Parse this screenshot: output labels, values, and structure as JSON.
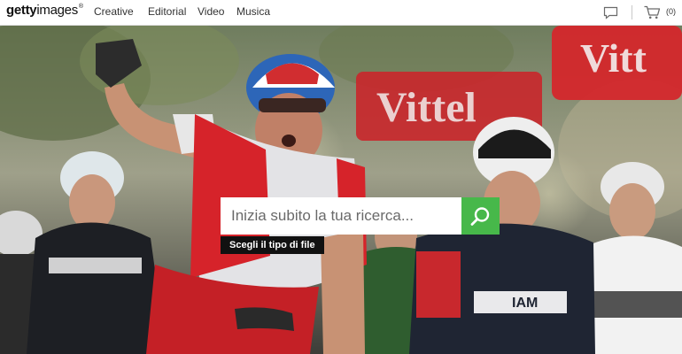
{
  "header": {
    "logo_bold": "getty",
    "logo_regular": "images",
    "logo_mark": "®",
    "nav": {
      "creative": "Creative",
      "editorial": "Editorial",
      "video": "Video",
      "music": "Musica"
    },
    "icons": {
      "chat": "chat-bubble-icon",
      "cart": "shopping-cart-icon"
    },
    "cart_count": "(0)"
  },
  "hero": {
    "banner_text": "Vittel",
    "search": {
      "placeholder": "Inizia subito la tua ricerca...",
      "button_icon": "search-icon"
    },
    "file_type_label": "Scegli il tipo di file"
  },
  "colors": {
    "accent": "#47b84a",
    "file_type_bg": "#111111",
    "banner_red": "#c8282d"
  }
}
